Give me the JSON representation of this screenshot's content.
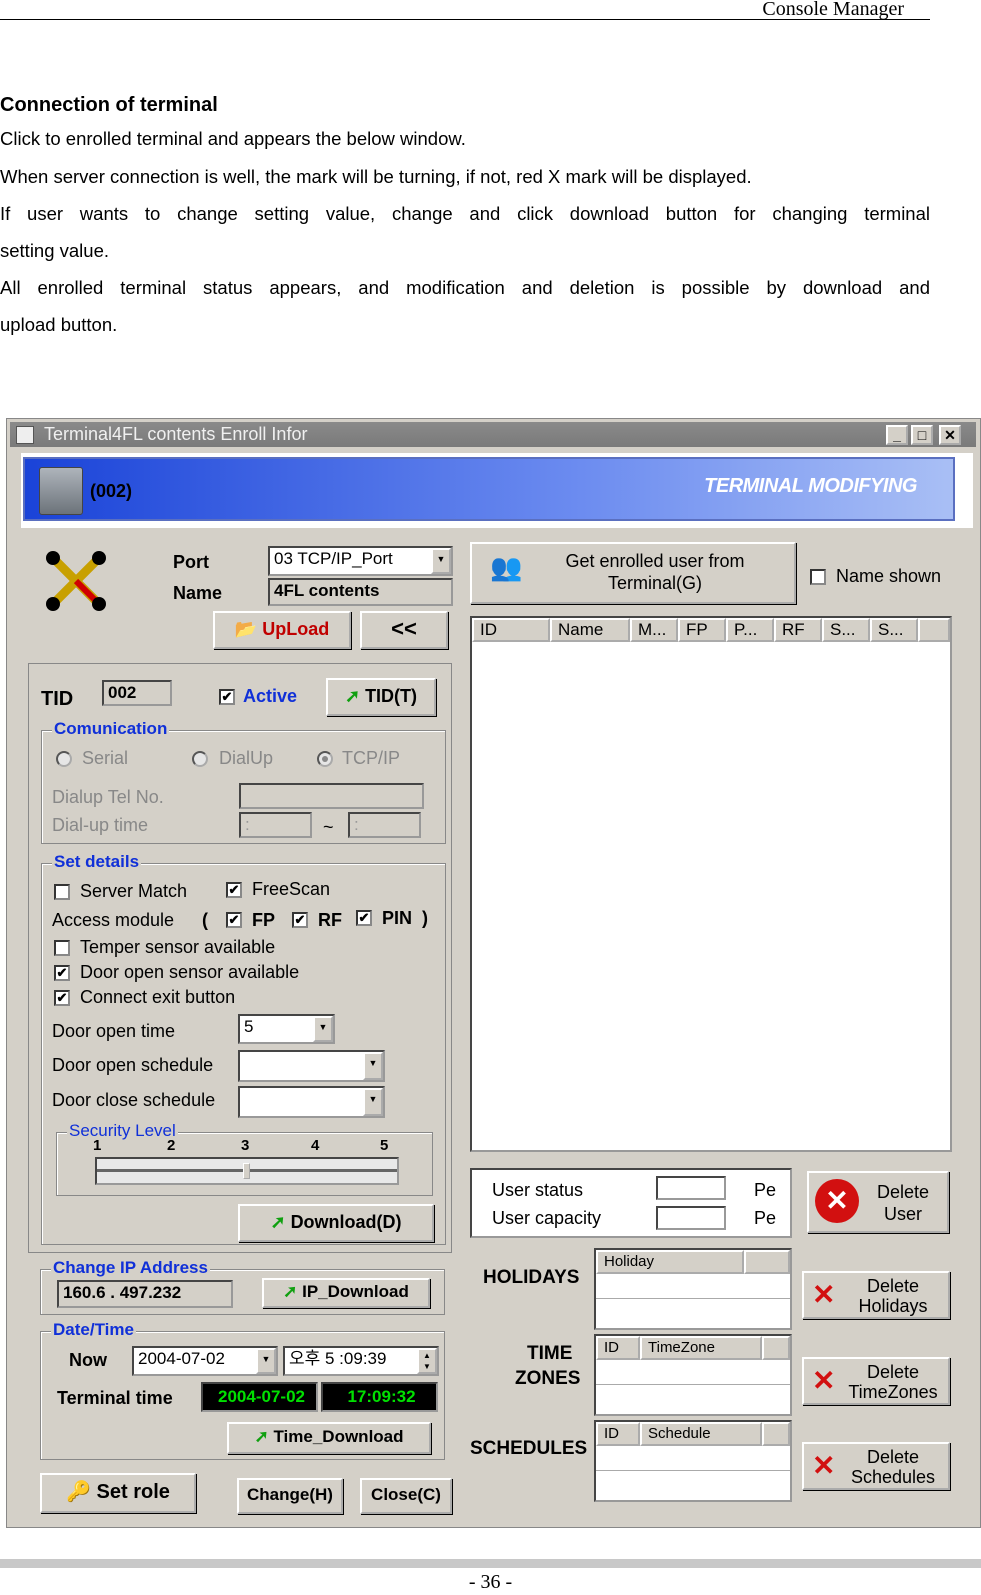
{
  "page": {
    "header": "Console Manager",
    "heading": "Connection of terminal",
    "paras": [
      "Click to enrolled terminal and appears the below window.",
      "When server connection is well, the mark will be turning, if not, red X mark will be displayed.",
      "If user wants to change setting value, change and click download button for changing terminal",
      "setting value.",
      "All enrolled terminal status appears, and modification and deletion is possible by download and",
      "upload button."
    ],
    "page_number": "- 36 -"
  },
  "window": {
    "title": "Terminal4FL contents Enroll Infor",
    "min": "_",
    "max": "□",
    "close": "✕",
    "banner_id": "(002)",
    "banner_title": "TERMINAL MODIFYING",
    "port_label": "Port",
    "port_value": "03 TCP/IP_Port",
    "name_label": "Name",
    "name_value": "4FL contents",
    "upload_btn": "UpLoad",
    "back_btn": "<<",
    "get_user_btn_1": "Get enrolled user from",
    "get_user_btn_2": "Terminal(G)",
    "name_shown": "Name shown",
    "user_columns": [
      "ID",
      "Name",
      "M...",
      "FP",
      "P...",
      "RF",
      "S...",
      "S..."
    ],
    "tid_label": "TID",
    "tid_value": "002",
    "active": "Active",
    "tid_btn": "TID(T)",
    "comm": {
      "title": "Comunication",
      "serial": "Serial",
      "dialup": "DialUp",
      "tcpip": "TCP/IP",
      "tel_label": "Dialup Tel No.",
      "time_label": "Dial-up time",
      "time_from": " :",
      "time_to": " :",
      "tilde": "~"
    },
    "set": {
      "title": "Set details",
      "server_match": "Server Match",
      "freescan": "FreeScan",
      "access_module": "Access module",
      "paren_open": "(",
      "paren_close": ")",
      "fp": "FP",
      "rf": "RF",
      "pin": "PIN",
      "temper": "Temper sensor available",
      "door_sensor": "Door open sensor available",
      "exit_button": "Connect exit button",
      "door_open_time": "Door open time",
      "door_open_time_value": "5",
      "door_open_schedule": "Door open schedule",
      "door_close_schedule": "Door close schedule",
      "security_level": "Security Level",
      "levels": [
        "1",
        "2",
        "3",
        "4",
        "5"
      ],
      "download_btn": "Download(D)"
    },
    "ip": {
      "title": "Change IP Address",
      "value": "160.6 . 497.232",
      "btn": "IP_Download"
    },
    "dt": {
      "title": "Date/Time",
      "now_label": "Now",
      "date": "2004-07-02",
      "time": "오후  5 :09:39",
      "terminal_time_label": "Terminal time",
      "term_date": "2004-07-02",
      "term_time": "17:09:32",
      "btn": "Time_Download"
    },
    "set_role_btn": "Set role",
    "change_btn": "Change(H)",
    "close_btn": "Close(C)",
    "status": {
      "user_status": "User status",
      "user_capacity": "User capacity",
      "pe1": "Pe",
      "pe2": "Pe",
      "delete_user": [
        "Delete",
        "User"
      ]
    },
    "holidays": {
      "label": "HOLIDAYS",
      "col": "Holiday",
      "delete": [
        "Delete",
        "Holidays"
      ]
    },
    "timezones": {
      "label1": "TIME",
      "label2": "ZONES",
      "col_id": "ID",
      "col": "TimeZone",
      "delete": [
        "Delete",
        "TimeZones"
      ]
    },
    "schedules": {
      "label": "SCHEDULES",
      "col_id": "ID",
      "col": "Schedule",
      "delete": [
        "Delete",
        "Schedules"
      ]
    },
    "check_mark": "✔"
  },
  "colors": {
    "banner": "#1a43d8",
    "accent": "#1030d8",
    "lcd_bg": "#000000",
    "lcd_fg": "#00e000",
    "red": "#d21010"
  }
}
